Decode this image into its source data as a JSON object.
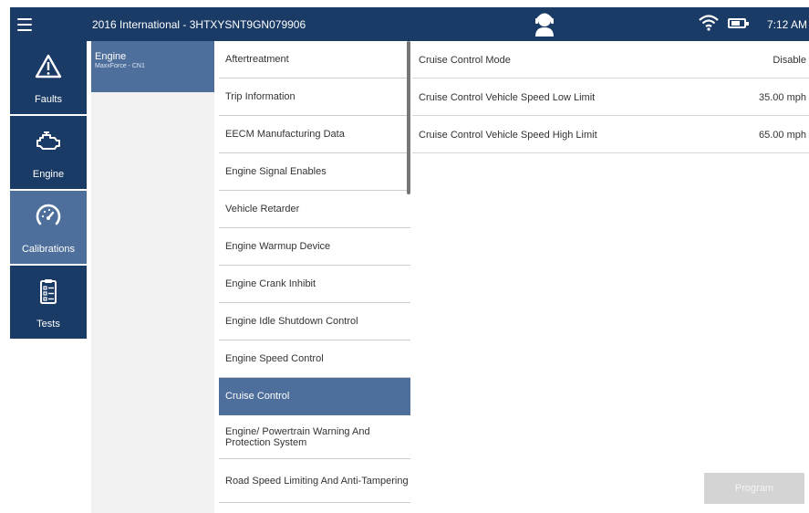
{
  "header": {
    "vehicle_title": "2016 International - 3HTXYSNT9GN079906",
    "time": "7:12 AM",
    "battery_level": 0.75
  },
  "nav": [
    {
      "label": "Faults",
      "icon": "warning-icon"
    },
    {
      "label": "Engine",
      "icon": "engine-icon"
    },
    {
      "label": "Calibrations",
      "icon": "gauge-icon",
      "active": true
    },
    {
      "label": "Tests",
      "icon": "clipboard-icon"
    }
  ],
  "subnav": {
    "title": "Engine",
    "subtitle": "MaxxForce - CN1"
  },
  "calibration_list": [
    "Aftertreatment",
    "Trip Information",
    "EECM Manufacturing Data",
    "Engine Signal Enables",
    "Vehicle Retarder",
    "Engine Warmup Device",
    "Engine Crank Inhibit",
    "Engine Idle Shutdown Control",
    "Engine Speed Control",
    "Cruise Control",
    "Engine/ Powertrain Warning And Protection System",
    "Road Speed Limiting And Anti-Tampering"
  ],
  "selected_calibration": "Cruise Control",
  "parameters": [
    {
      "name": "Cruise Control Mode",
      "value": "Disable"
    },
    {
      "name": "Cruise Control Vehicle Speed Low Limit",
      "value": "35.00 mph"
    },
    {
      "name": "Cruise Control Vehicle Speed High Limit",
      "value": "65.00 mph"
    }
  ],
  "program_button_label": "Program",
  "colors": {
    "header_bg": "#1a3b66",
    "active_bg": "#4e6f9b",
    "panel_bg": "#f2f2f2"
  }
}
